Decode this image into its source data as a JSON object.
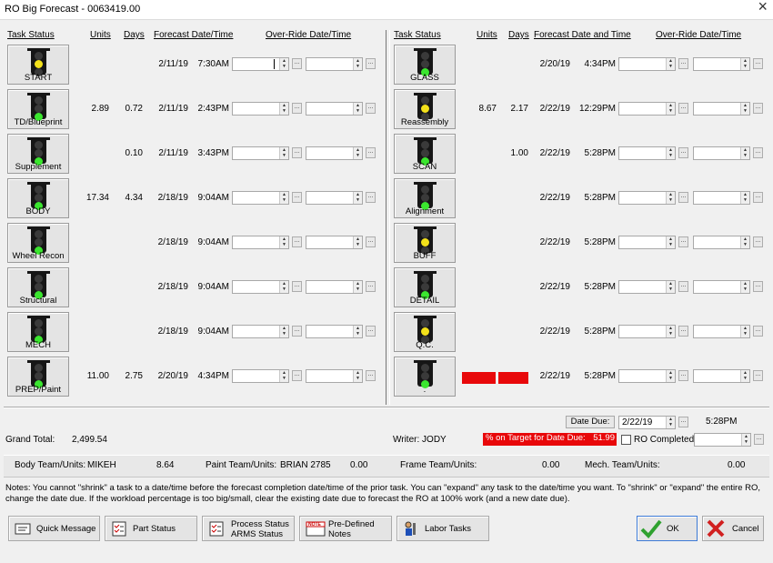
{
  "window": {
    "title": "RO Big Forecast - 0063419.00"
  },
  "headers": {
    "left": {
      "task_status": "Task Status",
      "units": "Units",
      "days": "Days",
      "forecast": "Forecast Date/Time",
      "override": "Over-Ride Date/Time"
    },
    "right": {
      "task_status": "Task Status",
      "units": "Units",
      "days": "Days",
      "forecast": "Forecast Date and Time",
      "override": "Over-Ride Date/Time"
    }
  },
  "colors": {
    "red_light": "#e3261d",
    "yellow_light": "#f3e11a",
    "green_light": "#3be62f",
    "off_light": "#3a3a3a",
    "alert_red": "#e8080a"
  },
  "left_tasks": [
    {
      "label": "START",
      "units": "",
      "days": "",
      "date": "2/11/19",
      "time": "7:30AM",
      "light": "yellow"
    },
    {
      "label": "TD/Blueprint",
      "units": "2.89",
      "days": "0.72",
      "date": "2/11/19",
      "time": "2:43PM",
      "light": "green"
    },
    {
      "label": "Supplement",
      "units": "",
      "days": "0.10",
      "date": "2/11/19",
      "time": "3:43PM",
      "light": "green"
    },
    {
      "label": "BODY",
      "units": "17.34",
      "days": "4.34",
      "date": "2/18/19",
      "time": "9:04AM",
      "light": "green"
    },
    {
      "label": "Wheel Recon",
      "units": "",
      "days": "",
      "date": "2/18/19",
      "time": "9:04AM",
      "light": "green"
    },
    {
      "label": "Structural",
      "units": "",
      "days": "",
      "date": "2/18/19",
      "time": "9:04AM",
      "light": "green"
    },
    {
      "label": "MECH",
      "units": "",
      "days": "",
      "date": "2/18/19",
      "time": "9:04AM",
      "light": "green"
    },
    {
      "label": "PREP/Paint",
      "units": "11.00",
      "days": "2.75",
      "date": "2/20/19",
      "time": "4:34PM",
      "light": "green"
    }
  ],
  "right_tasks": [
    {
      "label": "GLASS",
      "units": "",
      "days": "",
      "date": "2/20/19",
      "time": "4:34PM",
      "light": "green"
    },
    {
      "label": "Reassembly",
      "units": "8.67",
      "days": "2.17",
      "date": "2/22/19",
      "time": "12:29PM",
      "light": "yellow"
    },
    {
      "label": "SCAN",
      "units": "",
      "days": "1.00",
      "date": "2/22/19",
      "time": "5:28PM",
      "light": "green"
    },
    {
      "label": "Alignment",
      "units": "",
      "days": "",
      "date": "2/22/19",
      "time": "5:28PM",
      "light": "green"
    },
    {
      "label": "BUFF",
      "units": "",
      "days": "",
      "date": "2/22/19",
      "time": "5:28PM",
      "light": "yellow"
    },
    {
      "label": "DETAIL",
      "units": "",
      "days": "",
      "date": "2/22/19",
      "time": "5:28PM",
      "light": "green"
    },
    {
      "label": "Q.C.",
      "units": "",
      "days": "",
      "date": "2/22/19",
      "time": "5:28PM",
      "light": "yellow"
    },
    {
      "label": ".",
      "units": "",
      "days": "",
      "date": "2/22/19",
      "time": "5:28PM",
      "light": "green"
    }
  ],
  "summary": {
    "grand_total_label": "Grand Total:",
    "grand_total": "2,499.54",
    "writer": "Writer: JODY",
    "date_due_label": "Date Due:",
    "date_due": "2/22/19",
    "due_time": "5:28PM",
    "pct_label": "% on Target for Date Due:",
    "pct_value": "51.99",
    "ro_completed": "RO Completed"
  },
  "teams": {
    "body_label": "Body Team/Units:",
    "body_name": "MIKEH",
    "body_units": "8.64",
    "paint_label": "Paint Team/Units:",
    "paint_name": "BRIAN 2785",
    "paint_units": "0.00",
    "frame_label": "Frame Team/Units:",
    "frame_units": "0.00",
    "mech_label": "Mech. Team/Units:",
    "mech_units": "0.00"
  },
  "notes": "Notes:  You cannot \"shrink\" a task to a date/time before the forecast completion date/time of the prior task.  You can \"expand\" any task to the date/time you want.  To \"shrink\" or \"expand\" the entire RO, change the date due.  If the workload percentage is too big/small, clear the existing date due to forecast the RO at 100% work (and a new date due).",
  "buttons": {
    "quick_message": "Quick Message",
    "part_status": "Part Status",
    "process_status": "Process Status",
    "arms_status": "ARMS Status",
    "predefined": "Pre-Defined",
    "notes_label": "Notes",
    "note_icon_text": "NOTE",
    "labor_tasks": "Labor Tasks",
    "ok": "OK",
    "cancel": "Cancel"
  }
}
